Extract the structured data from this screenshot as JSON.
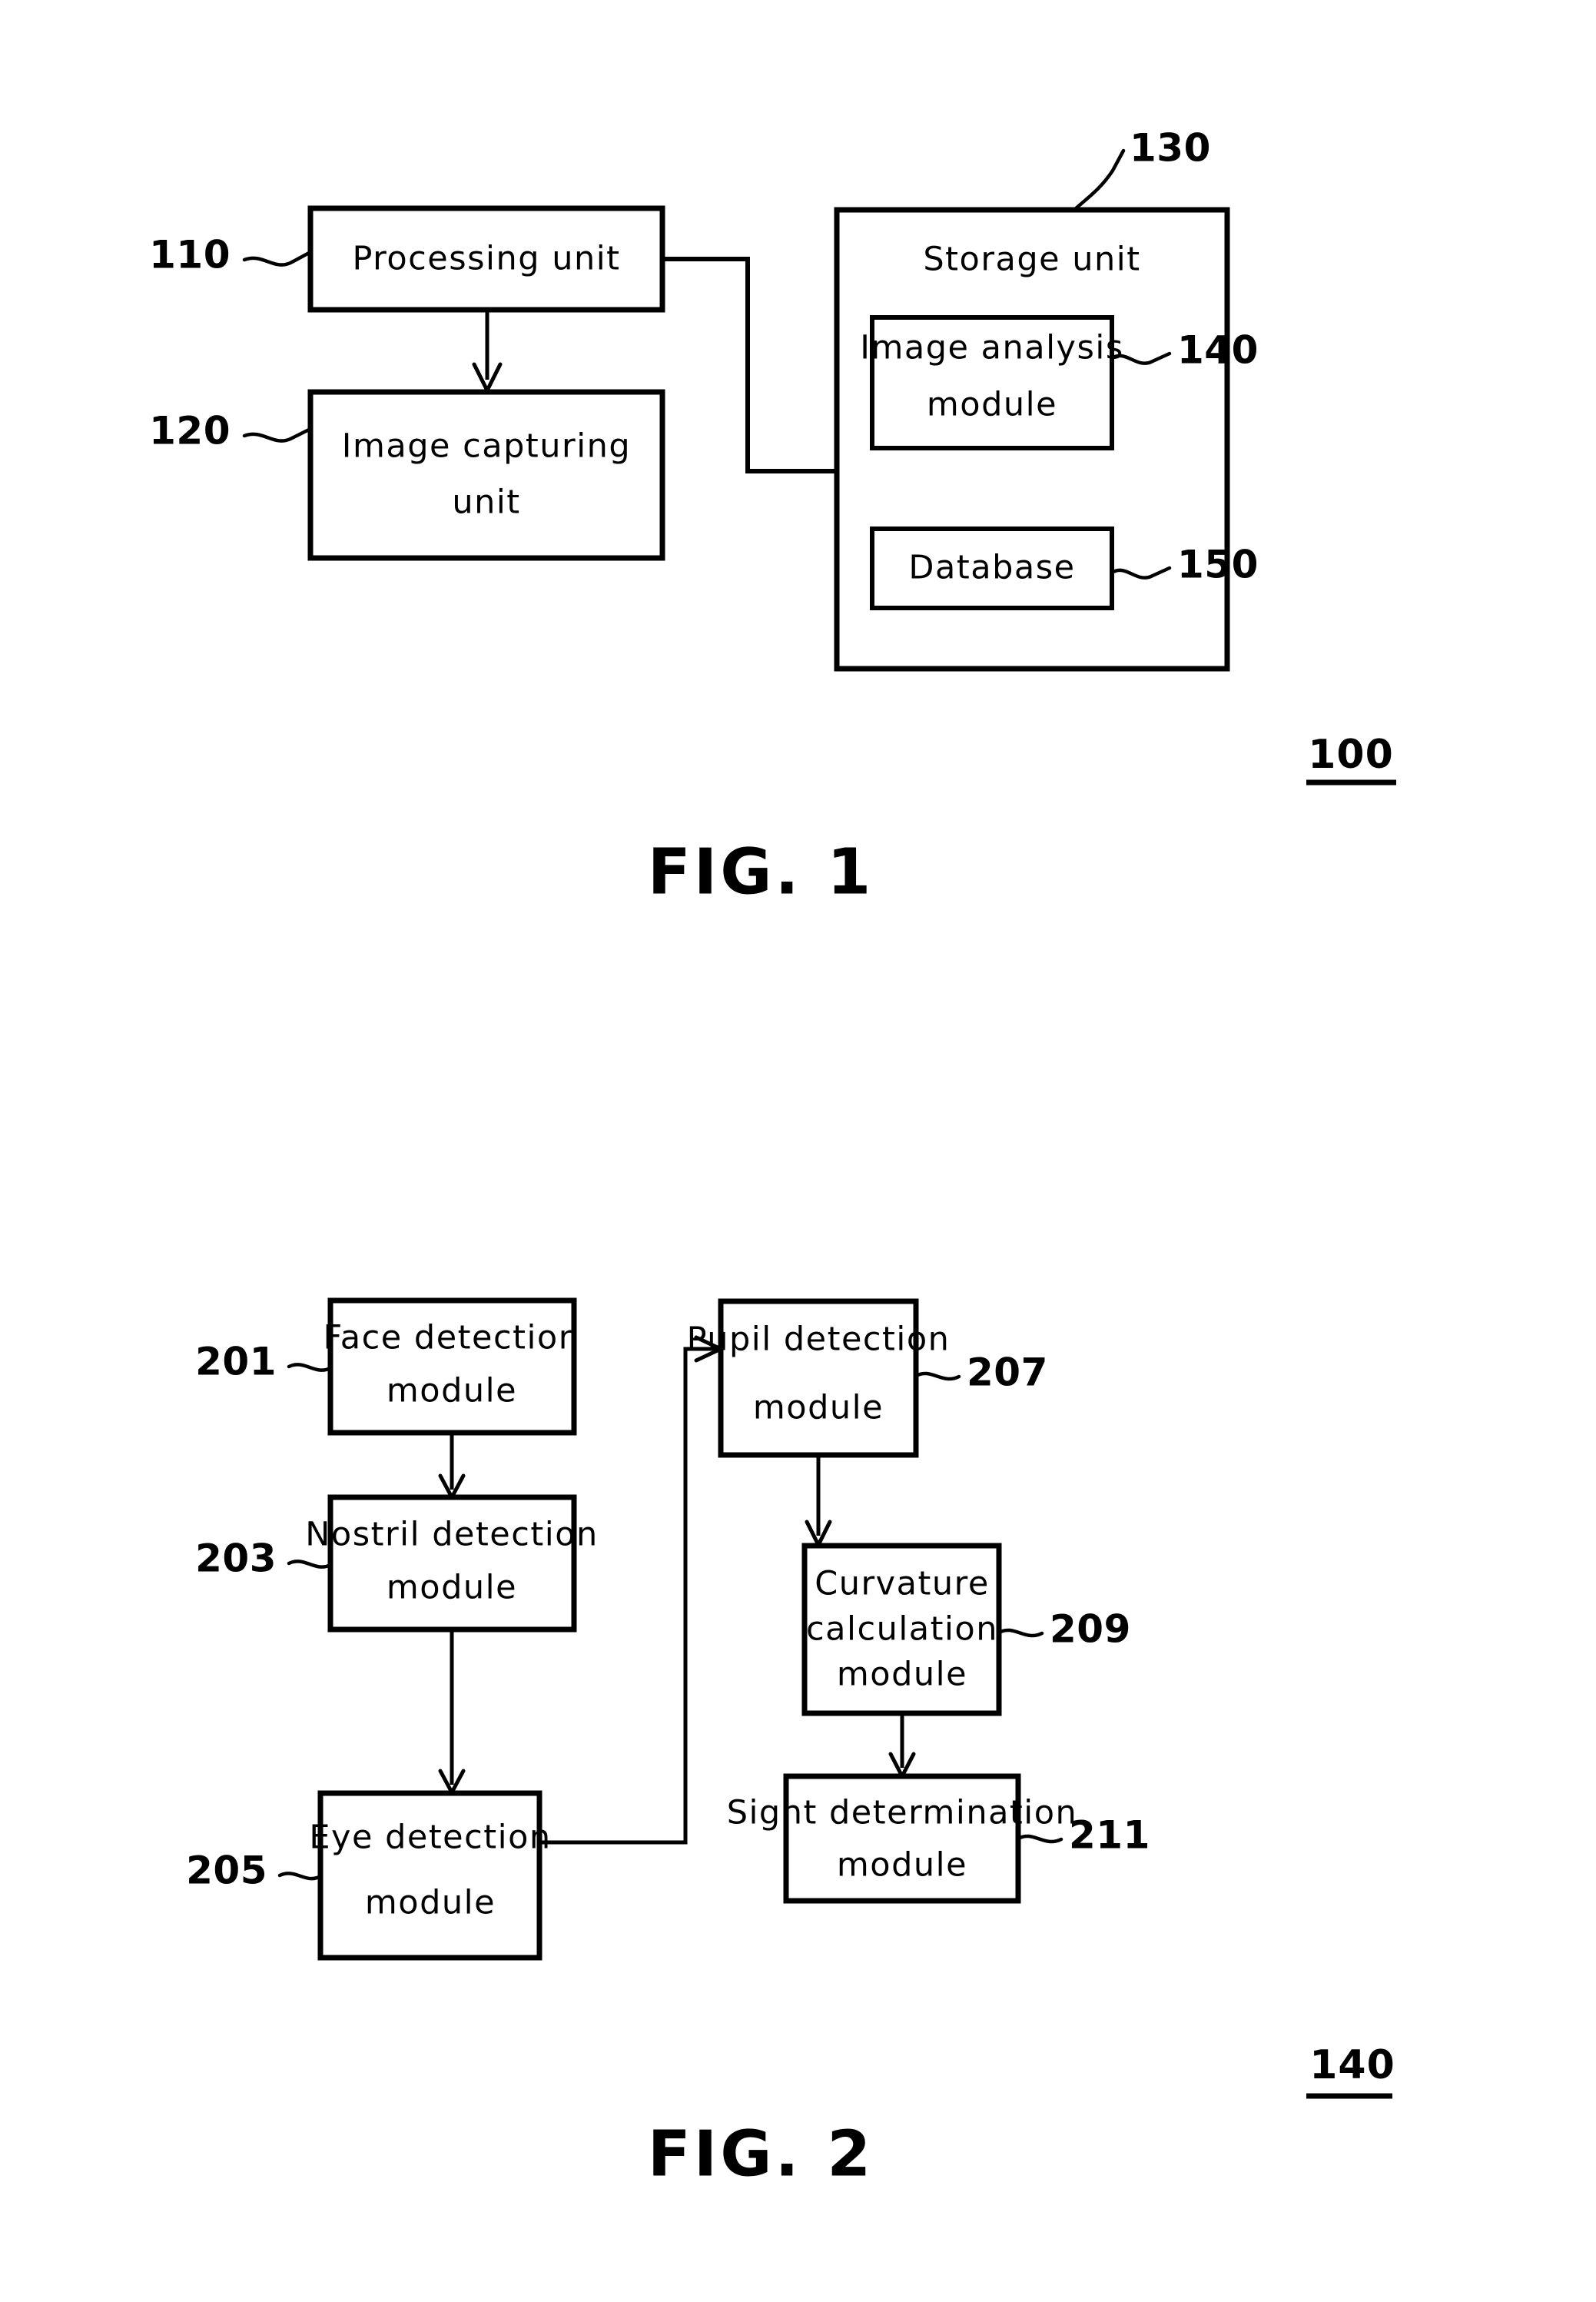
{
  "document": {
    "type": "patent-drawing-sheet",
    "figures": [
      {
        "id": "fig1",
        "caption": "FIG. 1",
        "assembly_number": "100",
        "blocks": [
          {
            "key": "processing_unit",
            "label_lines": [
              "Processing unit"
            ],
            "ref": "110"
          },
          {
            "key": "image_capturing_unit",
            "label_lines": [
              "Image  capturing",
              "unit"
            ],
            "ref": "120"
          },
          {
            "key": "storage_unit",
            "label_lines": [
              "Storage unit"
            ],
            "ref": "130"
          },
          {
            "key": "image_analysis_module",
            "label_lines": [
              "Image  analysis",
              "module"
            ],
            "ref": "140"
          },
          {
            "key": "database",
            "label_lines": [
              "Database"
            ],
            "ref": "150"
          }
        ]
      },
      {
        "id": "fig2",
        "caption": "FIG. 2",
        "assembly_number": "140",
        "blocks": [
          {
            "key": "face_detection_module",
            "label_lines": [
              "Face detection",
              "module"
            ],
            "ref": "201"
          },
          {
            "key": "nostril_detection_module",
            "label_lines": [
              "Nostril  detection",
              "module"
            ],
            "ref": "203"
          },
          {
            "key": "eye_detection_module",
            "label_lines": [
              "Eye  detection",
              "module"
            ],
            "ref": "205"
          },
          {
            "key": "pupil_detection_module",
            "label_lines": [
              "Pupil  detection",
              "module"
            ],
            "ref": "207"
          },
          {
            "key": "curvature_calculation_module",
            "label_lines": [
              "Curvature",
              "calculation",
              "module"
            ],
            "ref": "209"
          },
          {
            "key": "sight_determination_module",
            "label_lines": [
              "Sight  determination",
              "module"
            ],
            "ref": "211"
          }
        ]
      }
    ]
  },
  "fig1": {
    "caption": "FIG. 1",
    "assembly_number": "100",
    "processing_unit": {
      "line1": "Processing unit",
      "ref": "110"
    },
    "image_capturing_unit": {
      "line1": "Image  capturing",
      "line2": "unit",
      "ref": "120"
    },
    "storage_unit": {
      "line1": "Storage unit",
      "ref": "130"
    },
    "image_analysis_module": {
      "line1": "Image  analysis",
      "line2": "module",
      "ref": "140"
    },
    "database": {
      "line1": "Database",
      "ref": "150"
    }
  },
  "fig2": {
    "caption": "FIG. 2",
    "assembly_number": "140",
    "face_detection_module": {
      "line1": "Face detection",
      "line2": "module",
      "ref": "201"
    },
    "nostril_detection_module": {
      "line1": "Nostril  detection",
      "line2": "module",
      "ref": "203"
    },
    "eye_detection_module": {
      "line1": "Eye  detection",
      "line2": "module",
      "ref": "205"
    },
    "pupil_detection_module": {
      "line1": "Pupil  detection",
      "line2": "module",
      "ref": "207"
    },
    "curvature_calculation_module": {
      "line1": "Curvature",
      "line2": "calculation",
      "line3": "module",
      "ref": "209"
    },
    "sight_determination_module": {
      "line1": "Sight  determination",
      "line2": "module",
      "ref": "211"
    }
  },
  "colors": {
    "ink": "#000000",
    "paper": "#ffffff"
  }
}
